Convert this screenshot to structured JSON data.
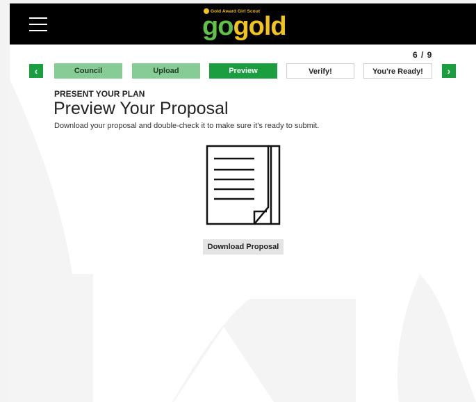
{
  "brand": {
    "tagline": "Gold Award Girl Scout",
    "word_go": "go",
    "word_gold": "gold",
    "colors": {
      "green": "#5fc14a",
      "gold": "#f2c319",
      "bar": "#000000"
    }
  },
  "header": {
    "menu_icon": "hamburger-menu-icon"
  },
  "progress": {
    "counter": "6 / 9",
    "current": 6,
    "total": 9,
    "prev_icon": "chevron-left-icon",
    "next_icon": "chevron-right-icon",
    "steps": [
      {
        "label": "Council",
        "state": "done"
      },
      {
        "label": "Upload",
        "state": "done"
      },
      {
        "label": "Preview",
        "state": "current"
      },
      {
        "label": "Verify!",
        "state": "todo"
      },
      {
        "label": "You're Ready!",
        "state": "todo"
      }
    ],
    "colors": {
      "done": "#87cc97",
      "current": "#1a9e3f"
    }
  },
  "main": {
    "eyebrow": "PRESENT YOUR PLAN",
    "title": "Preview Your Proposal",
    "description": "Download your proposal and double-check it to make sure it’s ready to submit.",
    "illustration_icon": "document-icon",
    "download_label": "Download Proposal"
  }
}
